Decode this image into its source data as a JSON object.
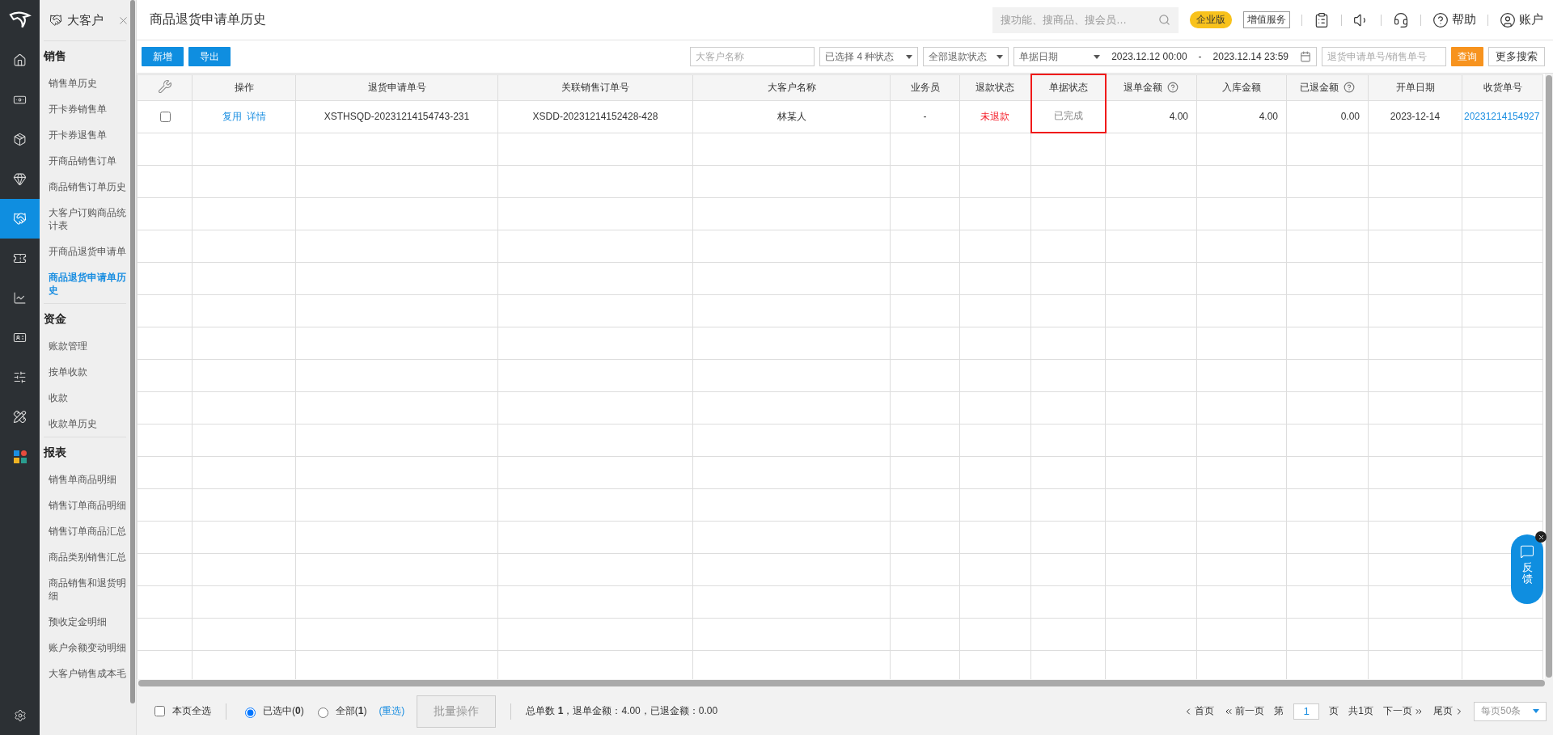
{
  "rail": {
    "items": [
      {
        "selected": false
      },
      {
        "selected": false
      },
      {
        "selected": false
      },
      {
        "selected": false
      },
      {
        "selected": true
      },
      {
        "selected": false
      },
      {
        "selected": false
      },
      {
        "selected": false
      },
      {
        "selected": false
      },
      {
        "selected": false
      },
      {
        "selected": false
      }
    ]
  },
  "sidebar": {
    "title": "大客户",
    "sections": [
      {
        "title": "销售",
        "items": [
          {
            "label": "销售单历史",
            "selected": false
          },
          {
            "label": "开卡券销售单",
            "selected": false
          },
          {
            "label": "开卡券退售单",
            "selected": false
          },
          {
            "label": "开商品销售订单",
            "selected": false
          },
          {
            "label": "商品销售订单历史",
            "selected": false
          },
          {
            "label": "大客户订购商品统计表",
            "selected": false
          },
          {
            "label": "开商品退货申请单",
            "selected": false
          },
          {
            "label": "商品退货申请单历史",
            "selected": true
          }
        ]
      },
      {
        "title": "资金",
        "items": [
          {
            "label": "账款管理",
            "selected": false
          },
          {
            "label": "按单收款",
            "selected": false
          },
          {
            "label": "收款",
            "selected": false
          },
          {
            "label": "收款单历史",
            "selected": false
          }
        ]
      },
      {
        "title": "报表",
        "items": [
          {
            "label": "销售单商品明细",
            "selected": false
          },
          {
            "label": "销售订单商品明细",
            "selected": false
          },
          {
            "label": "销售订单商品汇总",
            "selected": false
          },
          {
            "label": "商品类别销售汇总",
            "selected": false
          },
          {
            "label": "商品销售和退货明细",
            "selected": false
          },
          {
            "label": "预收定金明细",
            "selected": false
          },
          {
            "label": "账户余额变动明细",
            "selected": false
          },
          {
            "label": "大客户销售成本毛",
            "selected": false
          }
        ]
      }
    ]
  },
  "header": {
    "title": "商品退货申请单历史",
    "search": {
      "placeholder": "搜功能、搜商品、搜会员…"
    },
    "edition": "企业版",
    "service": "增值服务",
    "help": "帮助",
    "account": "账户"
  },
  "toolbar": {
    "buttons": [
      "新增",
      "导出"
    ],
    "customer": {
      "placeholder": "大客户名称"
    },
    "status_select": "已选择 4 种状态",
    "refund_select": "全部退款状态",
    "date_type": "单据日期",
    "date_from": "2023.12.12 00:00",
    "date_sep": "-",
    "date_to": "2023.12.14 23:59",
    "order_no": {
      "placeholder": "退货申请单号/销售单号"
    },
    "query": "查询",
    "more": "更多搜索"
  },
  "table": {
    "columns": [
      {
        "kind": "tools",
        "help": false,
        "highlighted": false
      },
      {
        "label": "操作",
        "help": false,
        "highlighted": false
      },
      {
        "label": "退货申请单号",
        "help": false,
        "highlighted": false
      },
      {
        "label": "关联销售订单号",
        "help": false,
        "highlighted": false
      },
      {
        "label": "大客户名称",
        "help": false,
        "highlighted": false
      },
      {
        "label": "业务员",
        "help": false,
        "highlighted": false
      },
      {
        "label": "退款状态",
        "help": false,
        "highlighted": false
      },
      {
        "label": "单据状态",
        "help": false,
        "highlighted": true
      },
      {
        "label": "退单金额",
        "help": true,
        "highlighted": false
      },
      {
        "label": "入库金额",
        "help": false,
        "highlighted": false
      },
      {
        "label": "已退金额",
        "help": true,
        "highlighted": false
      },
      {
        "label": "开单日期",
        "help": false,
        "highlighted": false
      },
      {
        "label": "收货单号",
        "help": false,
        "highlighted": false
      }
    ],
    "rows": [
      {
        "cells": [
          {
            "kind": "checkbox",
            "checked": false
          },
          {
            "kind": "actions",
            "links": [
              "复用",
              "详情"
            ]
          },
          {
            "kind": "text",
            "text": "XSTHSQD-20231214154743-231"
          },
          {
            "kind": "text",
            "text": "XSDD-20231214152428-428"
          },
          {
            "kind": "text",
            "text": "林某人"
          },
          {
            "kind": "text",
            "text": "-"
          },
          {
            "kind": "alert",
            "text": "未退款"
          },
          {
            "kind": "muted",
            "text": "已完成"
          },
          {
            "kind": "number",
            "text": "4.00"
          },
          {
            "kind": "number",
            "text": "4.00"
          },
          {
            "kind": "number",
            "text": "0.00"
          },
          {
            "kind": "text",
            "text": "2023-12-14"
          },
          {
            "kind": "link",
            "text": "20231214154927"
          }
        ]
      }
    ]
  },
  "footer": {
    "select_page": {
      "label": "本页全选",
      "checked": false
    },
    "scopes": [
      {
        "label": "已选中(**0**)",
        "selected": true
      },
      {
        "label": "全部(**1**)",
        "selected": false
      }
    ],
    "reset": "(重选)",
    "batch": {
      "label": "批量操作",
      "disabled": true
    },
    "summary": "总单数 **1**，退单金额：4.00，已退金额：0.00",
    "pager": {
      "first": "首页",
      "prev": "前一页",
      "page_prefix": "第",
      "page": "1",
      "page_suffix": "页",
      "total": "共1页",
      "next": "下一页",
      "last": "尾页",
      "size": "每页50条"
    }
  },
  "feedback": {
    "label": "反馈"
  }
}
